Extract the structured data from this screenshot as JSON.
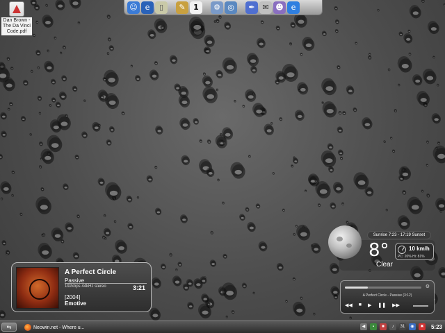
{
  "desktop": {
    "pdf_icon_label": "Dan Brown -\nThe Da Vinci\nCode.pdf"
  },
  "dock": {
    "calendar_day": "1",
    "items": [
      "finder-icon",
      "ie-icon",
      "trash-icon",
      "tools-icon",
      "calendar-icon",
      "settings-icon",
      "globe-icon",
      "pen-icon",
      "notes-icon",
      "people-icon",
      "browser-icon"
    ]
  },
  "music": {
    "artist": "A Perfect Circle",
    "album": "Passive",
    "info": "192kbps 44kHz stereo",
    "time": "3:21",
    "year": "[2004]",
    "genre": "Emotive"
  },
  "weather": {
    "sun": "Sunrise 7:23 - 17:19 Sunset",
    "temp": "8°",
    "condition": "Clear",
    "wind": "10 km/h",
    "pc_hi": "PC: 20%  Hi: 81%"
  },
  "mini_player": {
    "track": "A Perfect Circle - Passive (3:12)",
    "controls": [
      "◀◀",
      "■",
      "▶",
      "❚❚",
      "▶▶"
    ]
  },
  "taskbar": {
    "start_label": "⇆",
    "task_label": "Neowin.net - Where u...",
    "clock": "5:23",
    "tray_text": "31"
  },
  "colors": {
    "wallpaper": "#4d4d4d",
    "taskbar": "#2c2c2c",
    "widget_border": "#bbbbbb"
  }
}
